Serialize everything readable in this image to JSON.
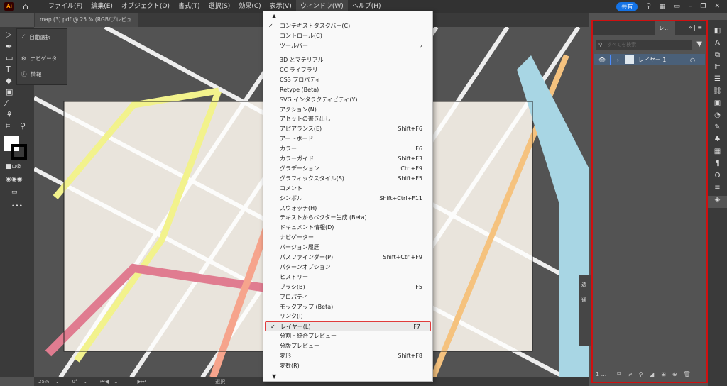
{
  "app": {
    "logo": "Ai",
    "share": "共有",
    "home_icon": "home-icon"
  },
  "menubar": [
    "ファイル(F)",
    "編集(E)",
    "オブジェクト(O)",
    "書式(T)",
    "選択(S)",
    "効果(C)",
    "表示(V)",
    "ウィンドウ(W)",
    "ヘルプ(H)"
  ],
  "document_tab": {
    "title": "map (3).pdf @ 25 % (RGB/プレビュー)",
    "close": "×"
  },
  "flyout": {
    "items": [
      "自動選択",
      "ナビゲータ...",
      "情報"
    ]
  },
  "window_menu": {
    "top": [
      {
        "label": "コンテキストタスクバー(C)",
        "checked": true
      },
      {
        "label": "コントロール(C)"
      },
      {
        "label": "ツールバー",
        "submenu": true
      }
    ],
    "items": [
      {
        "label": "3D とマテリアル"
      },
      {
        "label": "CC ライブラリ"
      },
      {
        "label": "CSS プロパティ"
      },
      {
        "label": "Retype (Beta)"
      },
      {
        "label": "SVG インタラクティビティ(Y)"
      },
      {
        "label": "アクション(N)"
      },
      {
        "label": "アセットの書き出し"
      },
      {
        "label": "アピアランス(E)",
        "shortcut": "Shift+F6"
      },
      {
        "label": "アートボード"
      },
      {
        "label": "カラー",
        "shortcut": "F6"
      },
      {
        "label": "カラーガイド",
        "shortcut": "Shift+F3"
      },
      {
        "label": "グラデーション",
        "shortcut": "Ctrl+F9"
      },
      {
        "label": "グラフィックスタイル(S)",
        "shortcut": "Shift+F5"
      },
      {
        "label": "コメント"
      },
      {
        "label": "シンボル",
        "shortcut": "Shift+Ctrl+F11"
      },
      {
        "label": "スウォッチ(H)"
      },
      {
        "label": "テキストからベクター生成 (Beta)"
      },
      {
        "label": "ドキュメント情報(D)"
      },
      {
        "label": "ナビゲーター"
      },
      {
        "label": "バージョン履歴"
      },
      {
        "label": "パスファインダー(P)",
        "shortcut": "Shift+Ctrl+F9"
      },
      {
        "label": "パターンオプション"
      },
      {
        "label": "ヒストリー"
      },
      {
        "label": "ブラシ(B)",
        "shortcut": "F5"
      },
      {
        "label": "プロパティ"
      },
      {
        "label": "モックアップ (Beta)"
      },
      {
        "label": "リンク(I)"
      },
      {
        "label": "レイヤー(L)",
        "shortcut": "F7",
        "checked": true,
        "highlighted": true
      },
      {
        "label": "分割・統合プレビュー"
      },
      {
        "label": "分版プレビュー"
      },
      {
        "label": "変形",
        "shortcut": "Shift+F8"
      },
      {
        "label": "変数(R)"
      }
    ]
  },
  "layers_panel": {
    "tab": "レ...",
    "search_placeholder": "すべてを検索",
    "layer_name": "レイヤー 1",
    "footer_count": "1 ..."
  },
  "side_panel": {
    "label1": "透",
    "label2": "通"
  },
  "status": {
    "zoom": "25%",
    "rotation": "0°",
    "artboard": "1",
    "mode": "選択"
  },
  "colors": {
    "highlight_border": "#e03c3c",
    "share": "#1473e6",
    "layer_row": "#4a6079"
  }
}
